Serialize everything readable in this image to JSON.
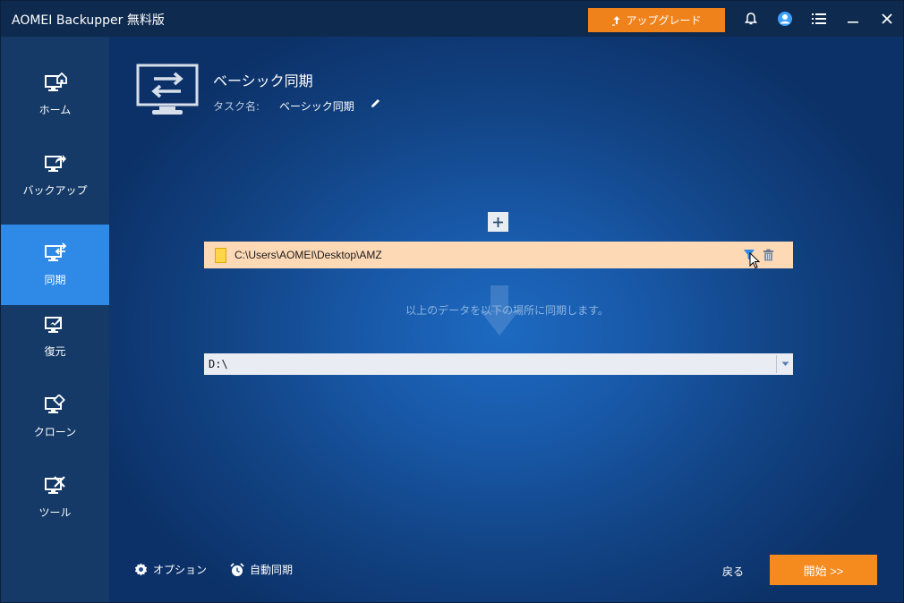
{
  "window": {
    "title": "AOMEI Backupper 無料版",
    "upgrade_label": "アップグレード"
  },
  "sidebar": {
    "items": [
      {
        "label": "ホーム",
        "icon": "home-icon"
      },
      {
        "label": "バックアップ",
        "icon": "backup-icon"
      },
      {
        "label": "同期",
        "icon": "sync-icon",
        "active": true
      },
      {
        "label": "復元",
        "icon": "restore-icon"
      },
      {
        "label": "クローン",
        "icon": "clone-icon"
      },
      {
        "label": "ツール",
        "icon": "tools-icon"
      }
    ]
  },
  "task": {
    "title": "ベーシック同期",
    "name_label": "タスク名:",
    "name_value": "ベーシック同期"
  },
  "source": {
    "path": "C:\\Users\\AOMEI\\Desktop\\AMZ"
  },
  "hint": "以上のデータを以下の場所に同期します。",
  "destination": {
    "path": "D:\\"
  },
  "footer": {
    "options_label": "オプション",
    "autosync_label": "自動同期",
    "back_label": "戻る",
    "start_label": "開始 >>"
  },
  "colors": {
    "accent_orange": "#f0821c",
    "active_nav": "#2e8ae6",
    "source_row": "#fdd9b6"
  }
}
